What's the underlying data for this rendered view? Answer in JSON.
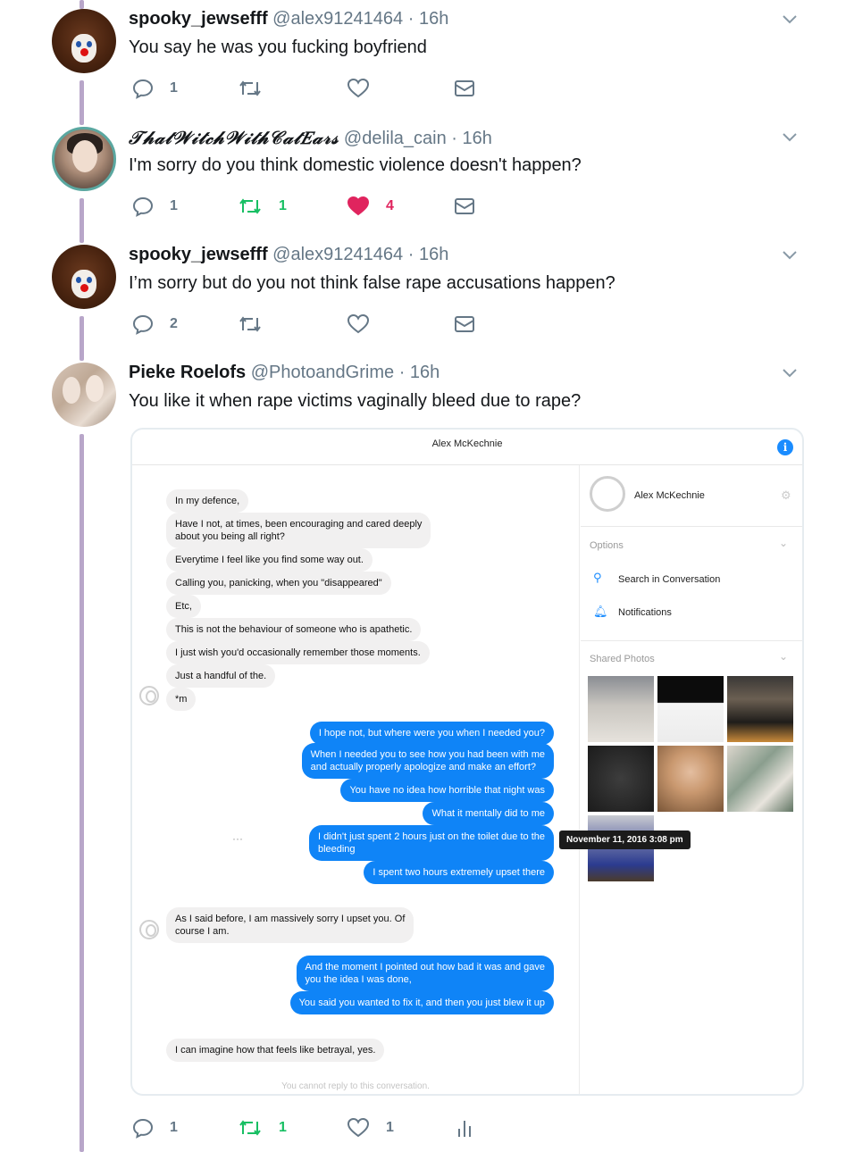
{
  "tweets": [
    {
      "name": "spooky_jewsefff",
      "handle": "@alex91241464",
      "dot": "·",
      "time": "16h",
      "text": "You say he was you fucking boyfriend",
      "replies": "1",
      "retweets": "",
      "likes": ""
    },
    {
      "name": "𝒯𝒽𝒶𝓉𝒲𝒾𝓉𝒸𝒽𝒲𝒾𝓉𝒽𝒞𝒶𝓉𝐸𝒶𝓇𝓈",
      "handle": "@delila_cain",
      "dot": "·",
      "time": "16h",
      "text": "I'm sorry do you think domestic violence doesn't happen?",
      "replies": "1",
      "retweets": "1",
      "likes": "4"
    },
    {
      "name": "spooky_jewsefff",
      "handle": "@alex91241464",
      "dot": "·",
      "time": "16h",
      "text": "I’m sorry but do you not think false rape accusations happen?",
      "replies": "2",
      "retweets": "",
      "likes": ""
    },
    {
      "name": "Pieke Roelofs",
      "handle": "@PhotoandGrime",
      "dot": "·",
      "time": "16h",
      "text": "You like it when rape victims vaginally bleed due to rape?",
      "replies": "1",
      "retweets": "1",
      "likes": "1"
    }
  ],
  "embed": {
    "title": "Alex McKechnie",
    "info_label": "i",
    "incoming_1": [
      "In my defence,",
      "Have I not, at times, been encouraging and cared deeply",
      "about you being all right?",
      "Everytime I feel like you find some way out.",
      "Calling you, panicking, when you \"disappeared\"",
      "Etc,",
      "This is not the behaviour of someone who is apathetic.",
      "I just wish you'd occasionally remember those moments.",
      "Just a handful of the.",
      "*m"
    ],
    "outgoing_1": [
      "I hope not, but where were you when I needed you?",
      "When I needed you to see how you had been with me",
      "and actually properly apologize and make an effort?",
      "You have no idea how horrible that night was",
      "What it mentally did to me",
      "I didn't just spent 2 hours just on the toilet due to the",
      "bleeding",
      "I spent two hours extremely upset there"
    ],
    "incoming_2": [
      "As I said before, I am massively sorry I upset you. Of",
      "course I am."
    ],
    "outgoing_2": [
      "And the moment I pointed out how bad it was and gave",
      "you the idea I was done,",
      "You said you wanted to fix it, and then you just blew it up"
    ],
    "incoming_3": [
      "I can imagine how that feels like betrayal, yes."
    ],
    "more_dots": "···",
    "tooltip": "November 11, 2016 3:08 pm",
    "no_reply": "You cannot reply to this conversation.",
    "sidebar": {
      "contact_name": "Alex McKechnie",
      "options_label": "Options",
      "search_label": "Search in Conversation",
      "notifications_label": "Notifications",
      "shared_photos_label": "Shared Photos"
    }
  },
  "colors": {
    "thread_line": "#b8a6c9",
    "retweet_active": "#17bf63",
    "like_active": "#e0245e",
    "messenger_blue": "#0f84f7",
    "icon_grey": "#657786"
  }
}
